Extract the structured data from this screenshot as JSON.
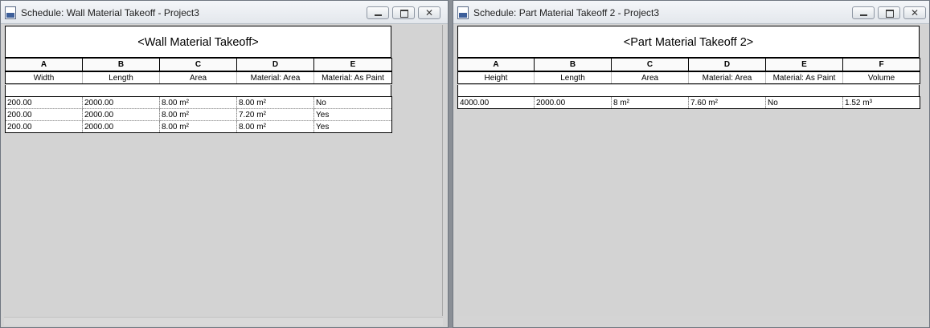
{
  "windows": {
    "left": {
      "title": "Schedule: Wall Material Takeoff - Project3",
      "schedule_title": "<Wall Material Takeoff>",
      "column_letters": [
        "A",
        "B",
        "C",
        "D",
        "E"
      ],
      "column_names": [
        "Width",
        "Length",
        "Area",
        "Material: Area",
        "Material: As Paint"
      ],
      "rows": [
        [
          "200.00",
          "2000.00",
          "8.00 m²",
          "8.00 m²",
          "No"
        ],
        [
          "200.00",
          "2000.00",
          "8.00 m²",
          "7.20 m²",
          "Yes"
        ],
        [
          "200.00",
          "2000.00",
          "8.00 m²",
          "8.00 m²",
          "Yes"
        ]
      ]
    },
    "right": {
      "title": "Schedule: Part Material Takeoff 2 - Project3",
      "schedule_title": "<Part Material Takeoff 2>",
      "column_letters": [
        "A",
        "B",
        "C",
        "D",
        "E",
        "F"
      ],
      "column_names": [
        "Height",
        "Length",
        "Area",
        "Material: Area",
        "Material: As Paint",
        "Volume"
      ],
      "rows": [
        [
          "4000.00",
          "2000.00",
          "8 m²",
          "7.60 m²",
          "No",
          "1.52 m³"
        ]
      ]
    }
  },
  "window_controls": {
    "close_glyph": "✕"
  },
  "colors": {
    "client_background": "#d3d3d3",
    "sheet_background": "#ffffff",
    "titlebar_top": "#f4f6f9",
    "titlebar_bottom": "#e3e7ec"
  },
  "icons": {
    "app": "revit-schedule-icon",
    "minimize": "minimize-icon",
    "restore": "restore-icon",
    "close": "close-icon"
  }
}
